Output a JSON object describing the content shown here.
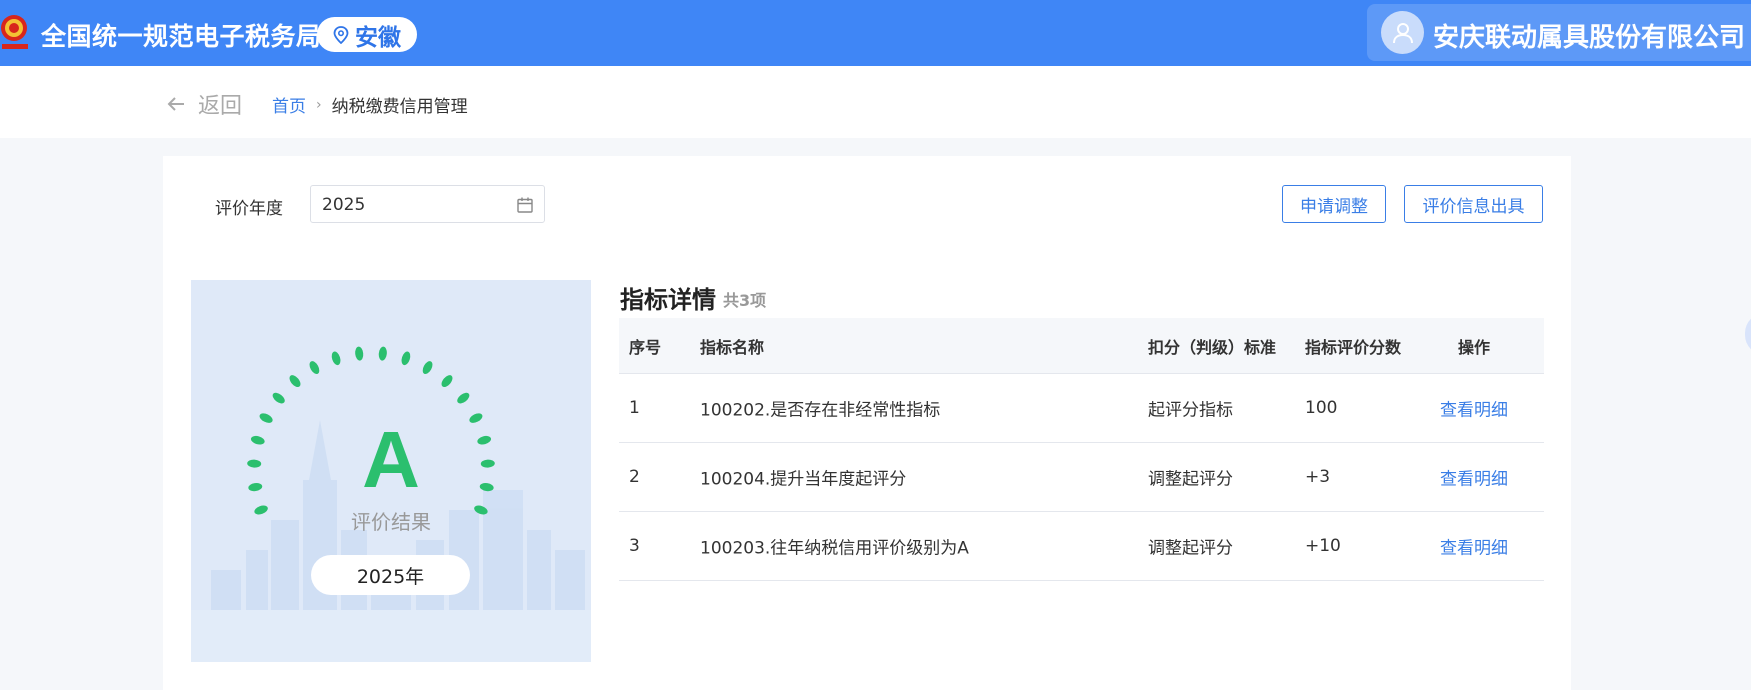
{
  "header": {
    "site_title": "全国统一规范电子税务局",
    "region": "安徽",
    "company": "安庆联动属具股份有限公司"
  },
  "nav": {
    "back": "返回",
    "breadcrumb_home": "首页",
    "breadcrumb_current": "纳税缴费信用管理"
  },
  "filter": {
    "year_label": "评价年度",
    "year_value": "2025"
  },
  "actions": {
    "apply_adjust": "申请调整",
    "issue_info": "评价信息出具"
  },
  "grade": {
    "letter": "A",
    "label": "评价结果",
    "year": "2025年",
    "color": "#2bbf6e"
  },
  "details": {
    "title": "指标详情",
    "count": "共3项",
    "columns": [
      "序号",
      "指标名称",
      "扣分（判级）标准",
      "指标评价分数",
      "操作"
    ],
    "rows": [
      {
        "no": "1",
        "name": "100202.是否存在非经常性指标",
        "standard": "起评分指标",
        "score": "100",
        "action": "查看明细"
      },
      {
        "no": "2",
        "name": "100204.提升当年度起评分",
        "standard": "调整起评分",
        "score": "+3",
        "action": "查看明细"
      },
      {
        "no": "3",
        "name": "100203.往年纳税信用评价级别为A",
        "standard": "调整起评分",
        "score": "+10",
        "action": "查看明细"
      }
    ]
  },
  "colors": {
    "header_bg": "#3f86f6",
    "link": "#3a7ee6"
  }
}
